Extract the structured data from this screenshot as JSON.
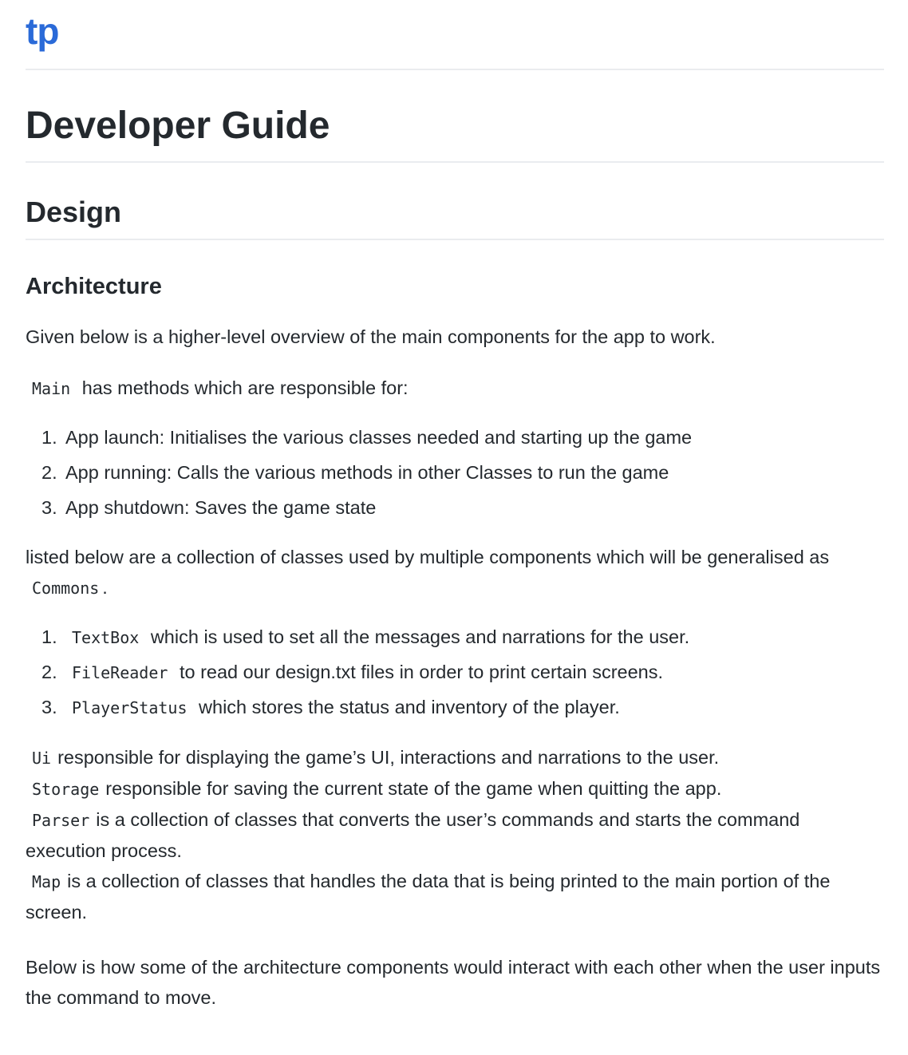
{
  "site": {
    "logo": "tp"
  },
  "title": "Developer Guide",
  "h2_design": "Design",
  "h3_architecture": "Architecture",
  "intro": "Given below is a higher-level overview of the main components for the app to work.",
  "main_para": {
    "code": "Main",
    "text": "has methods which are responsible for:"
  },
  "main_list": [
    {
      "num": "1.",
      "text": "App launch: Initialises the various classes needed and starting up the game"
    },
    {
      "num": "2.",
      "text": "App running: Calls the various methods in other Classes to run the game"
    },
    {
      "num": "3.",
      "text": "App shutdown: Saves the game state"
    }
  ],
  "commons_para": {
    "text": "listed below are a collection of classes used by multiple components which will be generalised as",
    "code": "Commons",
    "end": "."
  },
  "commons_list": [
    {
      "num": "1.",
      "code": "TextBox",
      "text": "which is used to set all the messages and narrations for the user."
    },
    {
      "num": "2.",
      "code": "FileReader",
      "text": "to read our design.txt files in order to print certain screens."
    },
    {
      "num": "3.",
      "code": "PlayerStatus",
      "text": "which stores the status and inventory of the player."
    }
  ],
  "components": [
    {
      "code": "Ui",
      "text": "responsible for displaying the game’s UI, interactions and narrations to the user."
    },
    {
      "code": "Storage",
      "text": "responsible for saving the current state of the game when quitting the app."
    },
    {
      "code": "Parser",
      "text": "is a collection of classes that converts the user’s commands and starts the command execution process."
    },
    {
      "code": "Map",
      "text": "is a collection of classes that handles the data that is being printed to the main portion of the screen."
    }
  ],
  "outro": "Below is how some of the architecture components would interact with each other when the user inputs the command to move."
}
